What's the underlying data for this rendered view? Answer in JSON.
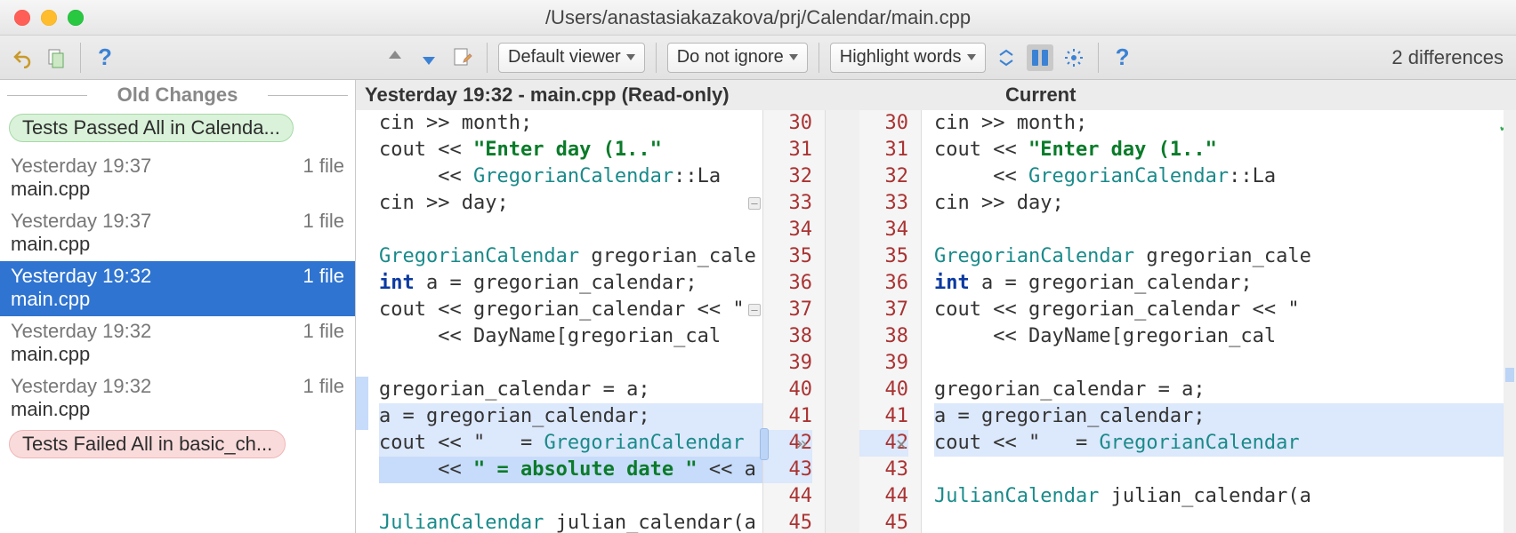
{
  "window": {
    "title": "/Users/anastasiakazakova/prj/Calendar/main.cpp"
  },
  "toolbar": {
    "viewer": "Default viewer",
    "ignore": "Do not ignore",
    "highlight": "Highlight words",
    "diff_count": "2 differences"
  },
  "sidebar": {
    "header": "Old Changes",
    "pill_pass": "Tests Passed All in Calenda...",
    "pill_fail": "Tests Failed All in basic_ch...",
    "entries": [
      {
        "time": "Yesterday 19:37",
        "files": "1 file",
        "name": "main.cpp"
      },
      {
        "time": "Yesterday 19:37",
        "files": "1 file",
        "name": "main.cpp"
      },
      {
        "time": "Yesterday 19:32",
        "files": "1 file",
        "name": "main.cpp"
      },
      {
        "time": "Yesterday 19:32",
        "files": "1 file",
        "name": "main.cpp"
      },
      {
        "time": "Yesterday 19:32",
        "files": "1 file",
        "name": "main.cpp"
      }
    ],
    "selected_index": 2
  },
  "diff": {
    "left_header": "Yesterday 19:32 - main.cpp (Read-only)",
    "right_header": "Current",
    "line_start": 30,
    "line_end": 45,
    "left_lines": {
      "30": "cin >> month;",
      "31": "cout << \"Enter day (1..\"",
      "32": "     << GregorianCalendar::La",
      "33": "cin >> day;",
      "34": "",
      "35": "GregorianCalendar gregorian_cale",
      "36": "int a = gregorian_calendar;",
      "37": "cout << gregorian_calendar << \" ",
      "38": "     << DayName[gregorian_cal",
      "39": "",
      "40": "gregorian_calendar = a;",
      "41": "a = gregorian_calendar;",
      "42": "cout << \"   = GregorianCalendar",
      "43": "     << \" = absolute date \" << a",
      "44": "",
      "45": "JulianCalendar julian_calendar(a"
    },
    "right_lines": {
      "30": "cin >> month;",
      "31": "cout << \"Enter day (1..\"",
      "32": "     << GregorianCalendar::La",
      "33": "cin >> day;",
      "34": "",
      "35": "GregorianCalendar gregorian_cale",
      "36": "int a = gregorian_calendar;",
      "37": "cout << gregorian_calendar << \" ",
      "38": "     << DayName[gregorian_cal",
      "39": "",
      "40": "gregorian_calendar = a;",
      "41": "a = gregorian_calendar;",
      "42": "cout << \"   = GregorianCalendar",
      "43": "",
      "44": "JulianCalendar julian_calendar(a",
      "45": ""
    }
  }
}
